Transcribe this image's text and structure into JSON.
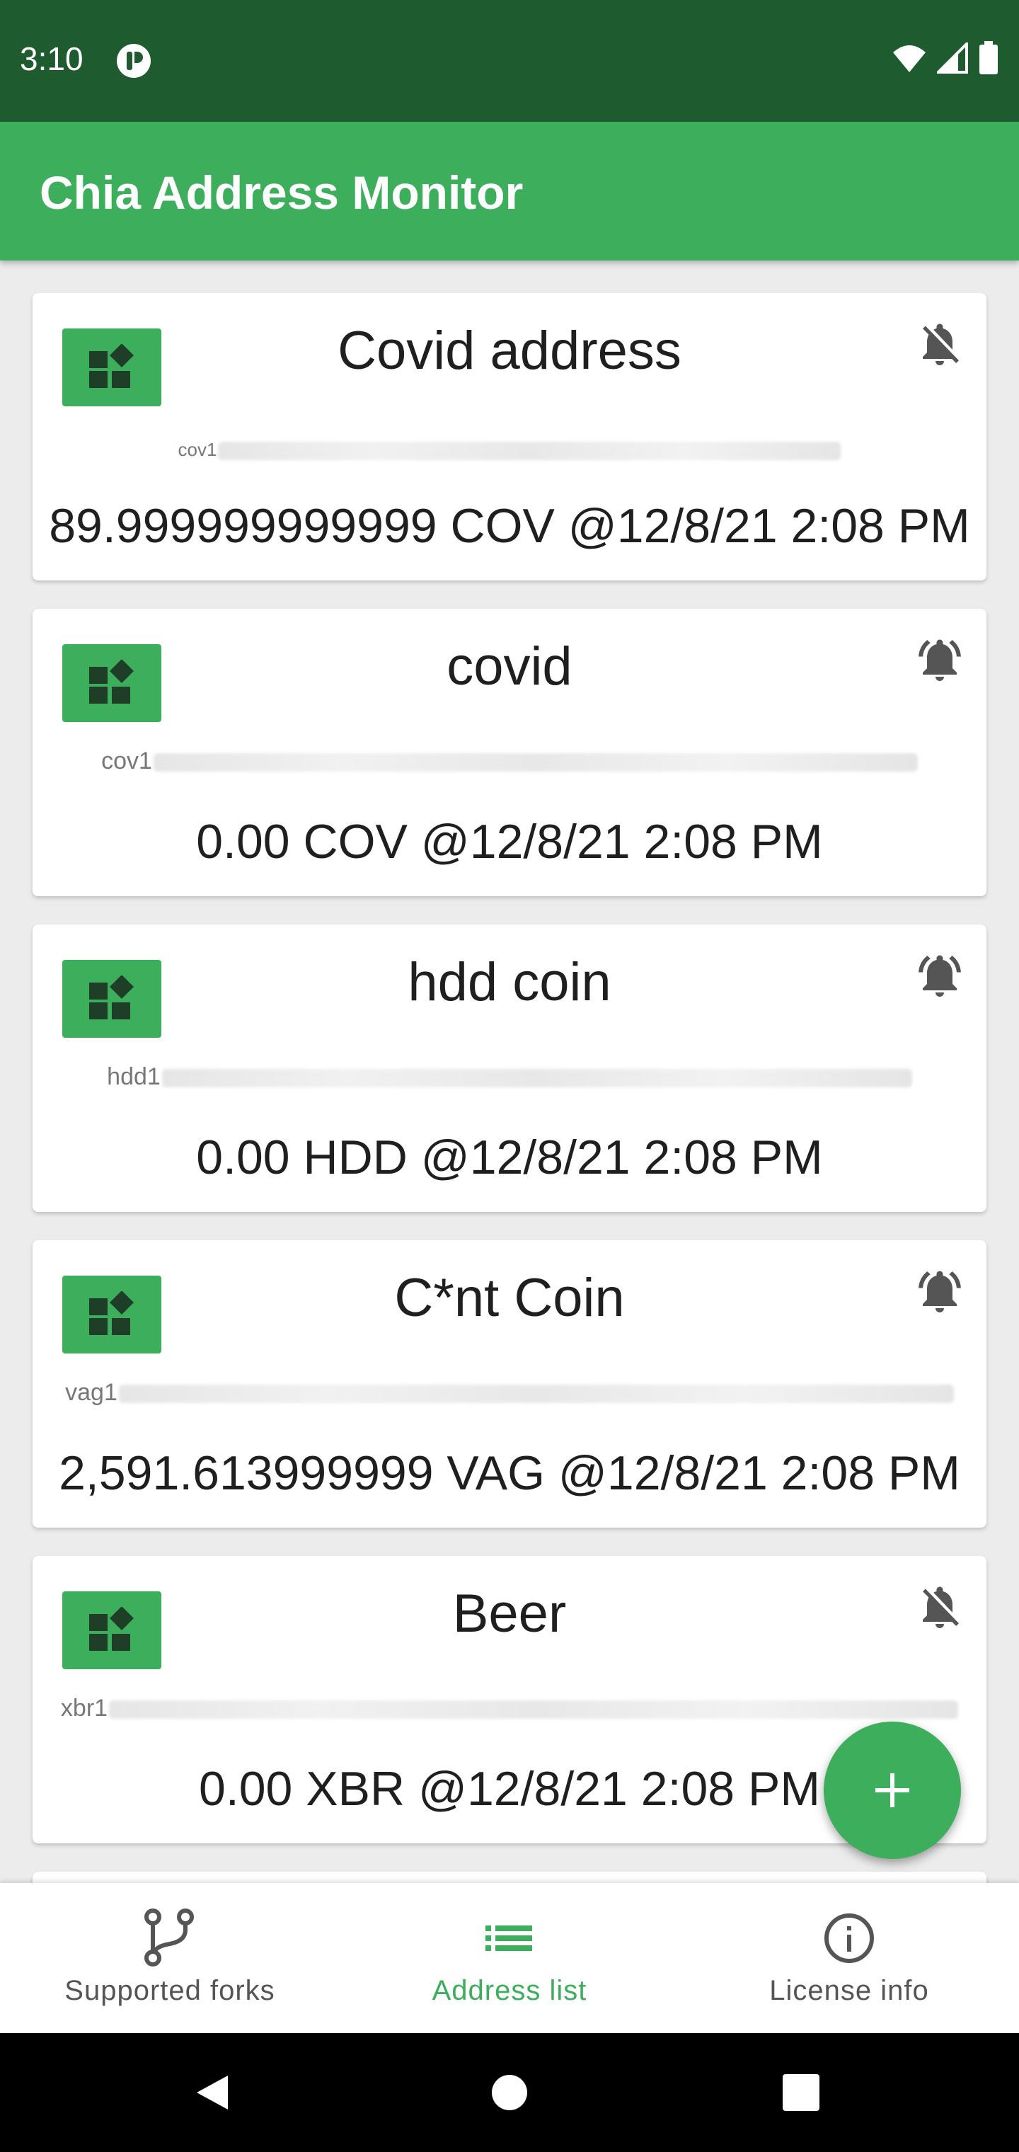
{
  "status_bar": {
    "time": "3:10"
  },
  "app_bar": {
    "title": "Chia Address Monitor"
  },
  "cards": [
    {
      "title": "Covid address",
      "address_prefix": "cov1",
      "balance": "89.999999999999 COV @12/8/21 2:08 PM",
      "notifications": "off",
      "icon": "wallet-icon"
    },
    {
      "title": "covid",
      "address_prefix": "cov1",
      "balance": "0.00 COV @12/8/21 2:08 PM",
      "notifications": "on",
      "icon": "wallet-icon"
    },
    {
      "title": "hdd coin",
      "address_prefix": "hdd1",
      "balance": "0.00 HDD @12/8/21 2:08 PM",
      "notifications": "on",
      "icon": "wallet-icon"
    },
    {
      "title": "C*nt Coin",
      "address_prefix": "vag1",
      "balance": "2,591.613999999 VAG @12/8/21 2:08 PM",
      "notifications": "on",
      "icon": "wallet-icon"
    },
    {
      "title": "Beer",
      "address_prefix": "xbr1",
      "balance": "0.00 XBR @12/8/21 2:08 PM",
      "notifications": "off",
      "icon": "wallet-icon"
    }
  ],
  "fab": {
    "icon": "plus-icon"
  },
  "bottom_nav": {
    "items": [
      {
        "label": "Supported forks",
        "icon": "fork-icon",
        "active": false
      },
      {
        "label": "Address list",
        "icon": "list-icon",
        "active": true
      },
      {
        "label": "License info",
        "icon": "info-icon",
        "active": false
      }
    ]
  },
  "colors": {
    "status_bar": "#1e5c2f",
    "primary": "#3dae5b",
    "background": "#ececec"
  }
}
